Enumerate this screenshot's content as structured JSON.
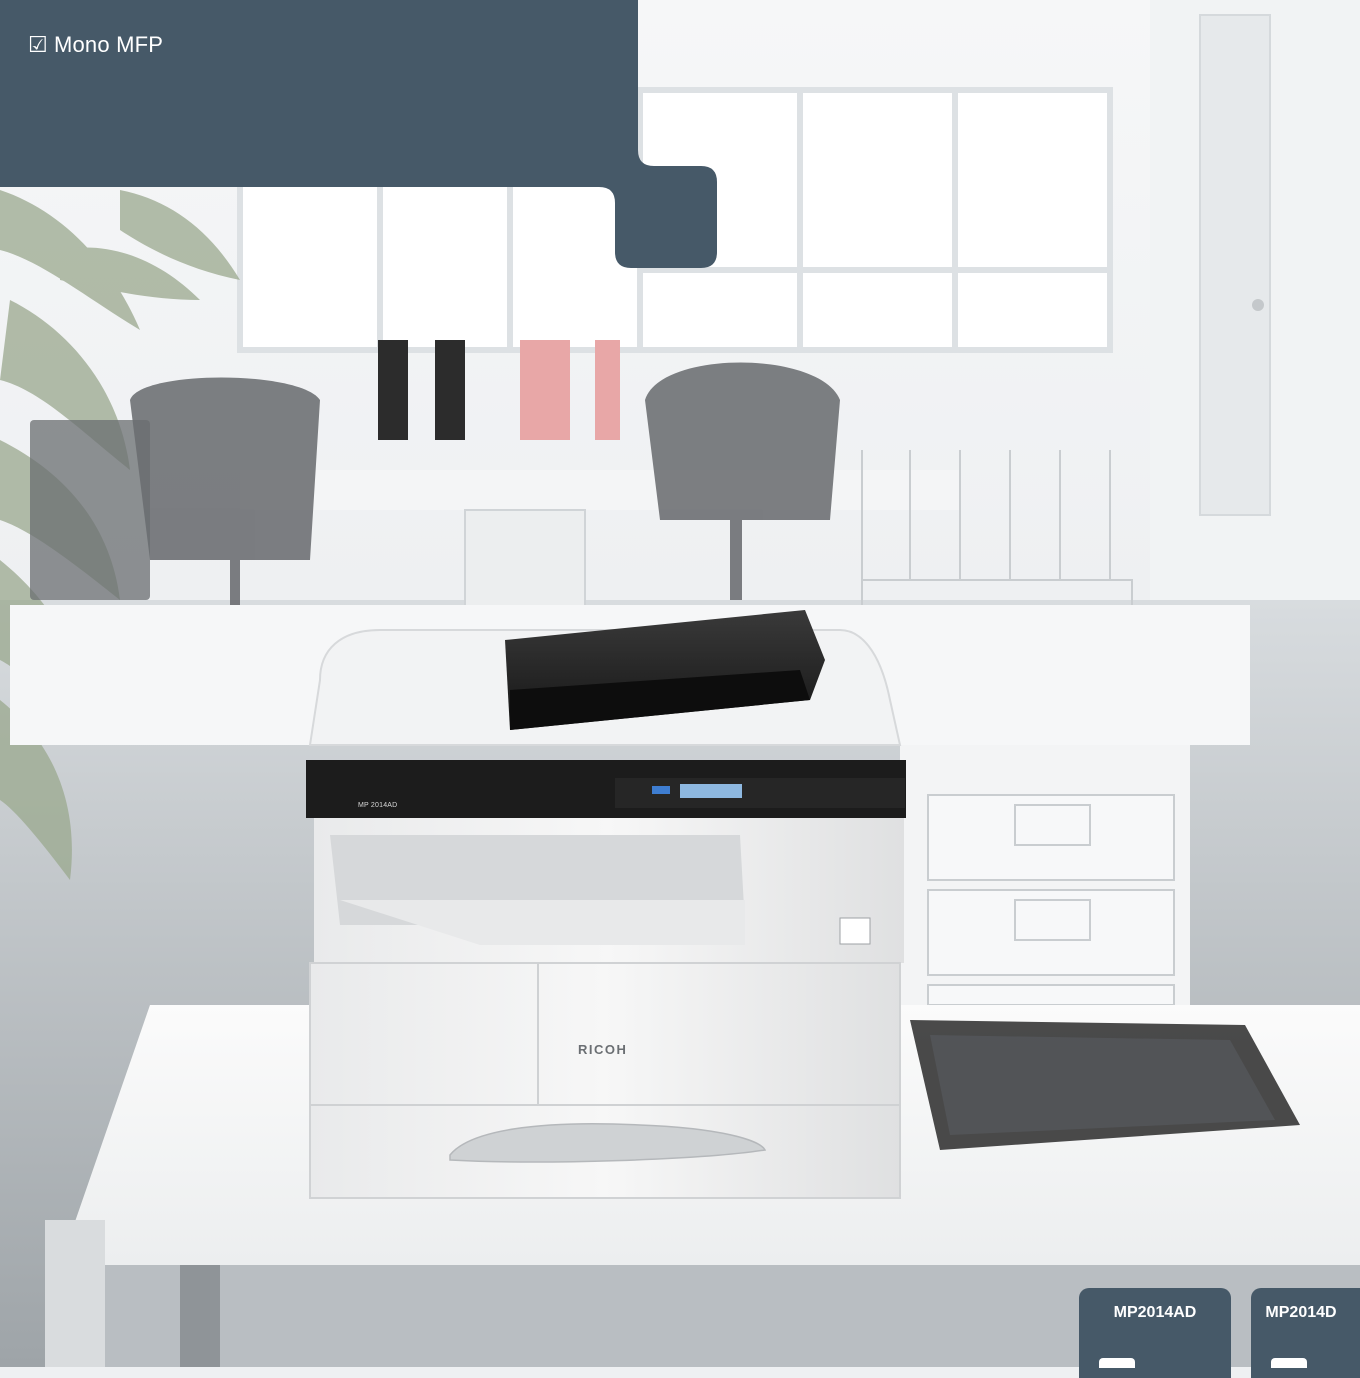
{
  "header": {
    "label": "Mono MFP",
    "checkbox_symbol": "☑",
    "panel_color": "#465968"
  },
  "product": {
    "model_plate": "MP 2014AD",
    "brand": "RICOH"
  },
  "models": {
    "tab1": "MP2014AD",
    "tab2": "MP2014D"
  }
}
